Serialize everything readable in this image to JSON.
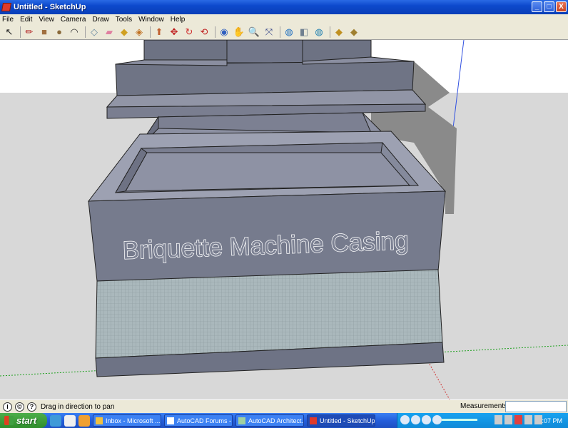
{
  "window": {
    "title": "Untitled - SketchUp",
    "minimize": "_",
    "maximize": "□",
    "close": "X"
  },
  "menu": [
    "File",
    "Edit",
    "View",
    "Camera",
    "Draw",
    "Tools",
    "Window",
    "Help"
  ],
  "toolbar": [
    {
      "name": "select-tool-icon",
      "glyph": "↖",
      "color": "#222222"
    },
    {
      "sep": true
    },
    {
      "name": "line-tool-icon",
      "glyph": "✏",
      "color": "#b02020"
    },
    {
      "name": "rectangle-tool-icon",
      "glyph": "■",
      "color": "#a07040"
    },
    {
      "name": "circle-tool-icon",
      "glyph": "●",
      "color": "#8a6a3a"
    },
    {
      "name": "arc-tool-icon",
      "glyph": "◠",
      "color": "#333333"
    },
    {
      "sep": true
    },
    {
      "name": "make-component-icon",
      "glyph": "◇",
      "color": "#6a8aa0"
    },
    {
      "name": "eraser-tool-icon",
      "glyph": "▰",
      "color": "#e080a0"
    },
    {
      "name": "tape-measure-icon",
      "glyph": "◆",
      "color": "#d0a020"
    },
    {
      "name": "paint-bucket-icon",
      "glyph": "◈",
      "color": "#c07020"
    },
    {
      "sep": true
    },
    {
      "name": "push-pull-icon",
      "glyph": "⬆",
      "color": "#c06030"
    },
    {
      "name": "move-tool-icon",
      "glyph": "✥",
      "color": "#c02020"
    },
    {
      "name": "rotate-tool-icon",
      "glyph": "↻",
      "color": "#d03030"
    },
    {
      "name": "follow-me-icon",
      "glyph": "⟲",
      "color": "#c02020"
    },
    {
      "sep": true
    },
    {
      "name": "orbit-tool-icon",
      "glyph": "◉",
      "color": "#3060c0"
    },
    {
      "name": "pan-tool-icon",
      "glyph": "✋",
      "color": "#555555"
    },
    {
      "name": "zoom-tool-icon",
      "glyph": "🔍",
      "color": "#333333"
    },
    {
      "name": "zoom-extents-icon",
      "glyph": "⤧",
      "color": "#334488"
    },
    {
      "sep": true
    },
    {
      "name": "get-models-icon",
      "glyph": "◍",
      "color": "#2070c0"
    },
    {
      "name": "share-model-icon",
      "glyph": "◧",
      "color": "#708090"
    },
    {
      "name": "share-component-icon",
      "glyph": "◍",
      "color": "#2080b0"
    },
    {
      "sep": true
    },
    {
      "name": "get-components-icon",
      "glyph": "◆",
      "color": "#c09020"
    },
    {
      "name": "share-components-icon",
      "glyph": "◆",
      "color": "#a08030"
    }
  ],
  "model": {
    "text": "Briquette Machine Casing"
  },
  "status": {
    "hint": "Drag in direction to pan",
    "measurements_label": "Measurements",
    "measurements_value": ""
  },
  "taskbar": {
    "start": "start",
    "tasks": [
      {
        "label": "Inbox - Microsoft ...",
        "active": false,
        "icon_color": "#f0c040"
      },
      {
        "label": "AutoCAD Forums - ...",
        "active": false,
        "icon_color": "#ffffff"
      },
      {
        "label": "AutoCAD Architect...",
        "active": false,
        "icon_color": "#a0d0a0"
      },
      {
        "label": "Untitled - SketchUp",
        "active": true,
        "icon_color": "#e03a2a"
      }
    ],
    "clock": "6:07 PM"
  }
}
